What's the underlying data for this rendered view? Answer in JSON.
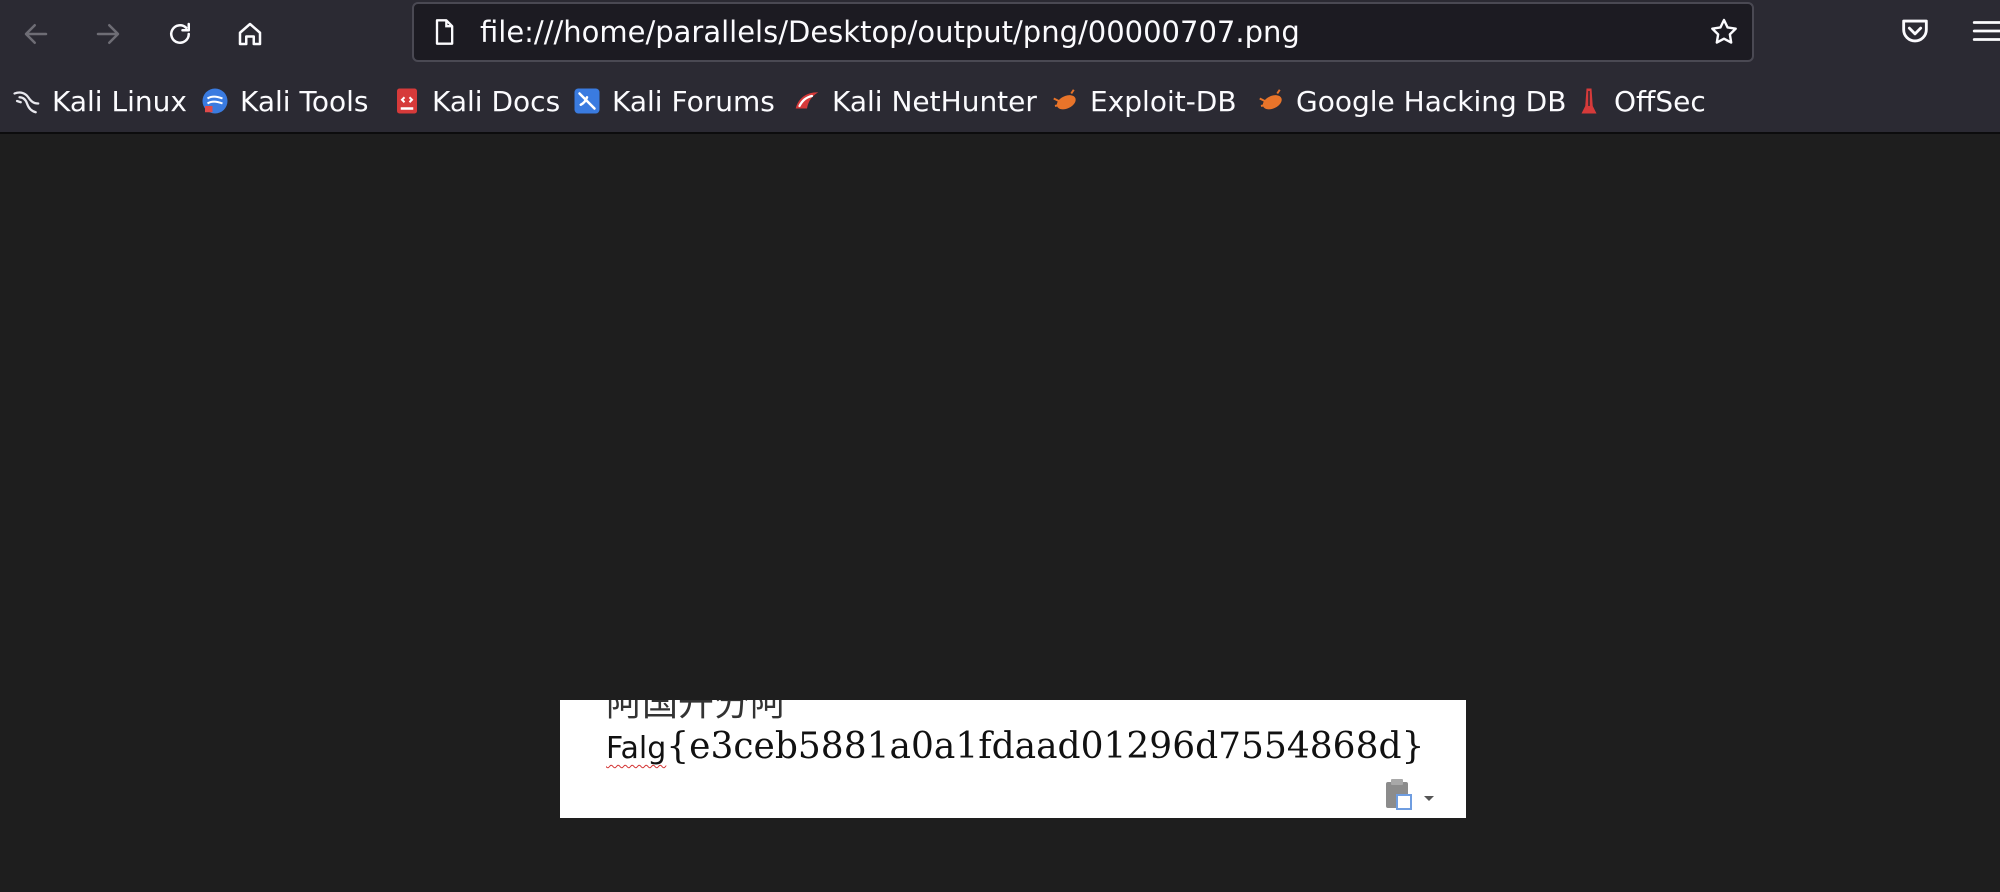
{
  "browser": {
    "url": "file:///home/parallels/Desktop/output/png/00000707.png",
    "nav_icons": [
      "back-icon",
      "forward-icon",
      "reload-icon",
      "home-icon"
    ],
    "right_icons": [
      "pocket-icon",
      "menu-icon"
    ]
  },
  "bookmarks": [
    {
      "label": "Kali Linux",
      "icon": "kali-dragon-icon"
    },
    {
      "label": "Kali Tools",
      "icon": "kali-tools-icon"
    },
    {
      "label": "Kali Docs",
      "icon": "kali-docs-icon"
    },
    {
      "label": "Kali Forums",
      "icon": "kali-forums-icon"
    },
    {
      "label": "Kali NetHunter",
      "icon": "kali-nethunter-icon"
    },
    {
      "label": "Exploit-DB",
      "icon": "exploit-db-icon"
    },
    {
      "label": "Google Hacking DB",
      "icon": "ghdb-icon"
    },
    {
      "label": "OffSec",
      "icon": "offsec-icon"
    }
  ],
  "image_content": {
    "cut_off_line": "阿国开分阿",
    "flag_prefix": "Falg",
    "flag_body": "{e3ceb5881a0a1fdaad01296d7554868d}",
    "paste_options_icon": "paste-options-icon"
  },
  "colors": {
    "toolbar_bg": "#2b2a33",
    "content_bg": "#1e1e1e",
    "text": "#fbfbfe",
    "spellcheck_underline": "#d23030"
  }
}
